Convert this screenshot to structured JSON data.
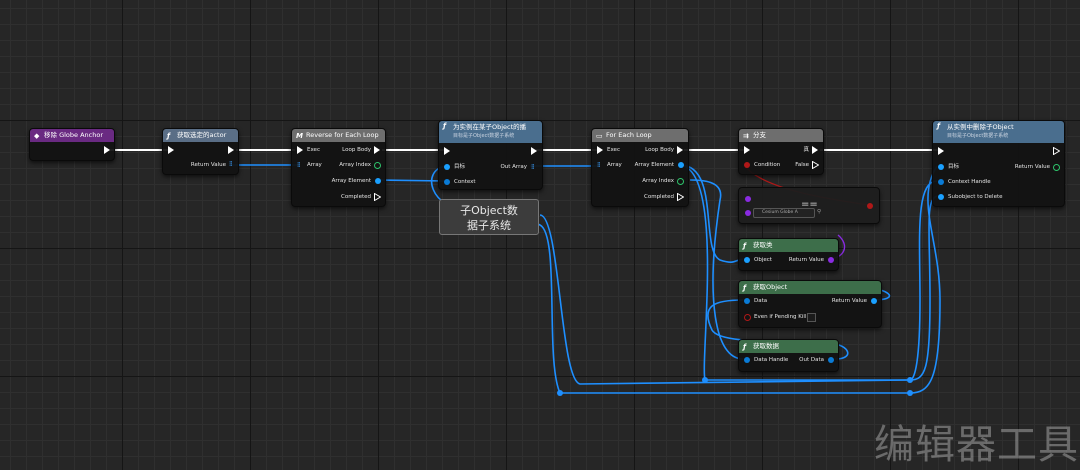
{
  "nodes": {
    "event": {
      "title": "移除 Globe Anchor",
      "color": "#6a2a82"
    },
    "get_selected": {
      "title": "获取选定的actor",
      "return": "Return Value",
      "color": "#5a6e86"
    },
    "reverse_loop": {
      "title": "Reverse for Each Loop",
      "exec": "Exec",
      "array": "Array",
      "loop_body": "Loop Body",
      "array_index": "Array Index",
      "array_element": "Array Element",
      "completed": "Completed",
      "color": "#6e6e6e"
    },
    "for_objects": {
      "title": "为实例在某子Object的播",
      "subtitle": "目标是子Object数据子系统",
      "target": "目标",
      "context": "Context",
      "out_array": "Out Array",
      "color": "#4a6e8e"
    },
    "for_each": {
      "title": "For Each Loop",
      "exec": "Exec",
      "array": "Array",
      "loop_body": "Loop Body",
      "array_element": "Array Element",
      "array_index": "Array Index",
      "completed": "Completed",
      "color": "#6e6e6e"
    },
    "branch": {
      "title": "分支",
      "condition": "Condition",
      "true_label": "真",
      "false_label": "False",
      "color": "#6e6e6e"
    },
    "equal": {
      "op": "==",
      "enum_value": "Cesium Globe A"
    },
    "get_class": {
      "title": "获取类",
      "object": "Object",
      "return": "Return Value",
      "color": "#3d6e4a"
    },
    "get_object": {
      "title": "获取Object",
      "data": "Data",
      "return": "Return Value",
      "even_if": "Even if Pending Kill",
      "color": "#3d6e4a"
    },
    "get_data": {
      "title": "获取数据",
      "handle": "Data Handle",
      "out": "Out Data",
      "color": "#3d6e4a"
    },
    "remove_object": {
      "title": "从实例中删除子Object",
      "subtitle": "目标是子Object数据子系统",
      "target": "目标",
      "context": "Context Handle",
      "subobject": "Subobject to Delete",
      "return": "Return Value",
      "color": "#4a6e8e"
    }
  },
  "comment": {
    "line1": "子Object数",
    "line2": "据子系统"
  },
  "watermark": "编辑器工具",
  "colors": {
    "exec": "#ffffff",
    "struct": "#0a7bd6",
    "object": "#1aa0ff",
    "bool": "#b01818",
    "class": "#8a2be2",
    "int": "#2ec46b",
    "wire_exec": "#ffffff",
    "wire_data": "#1e8fff"
  }
}
